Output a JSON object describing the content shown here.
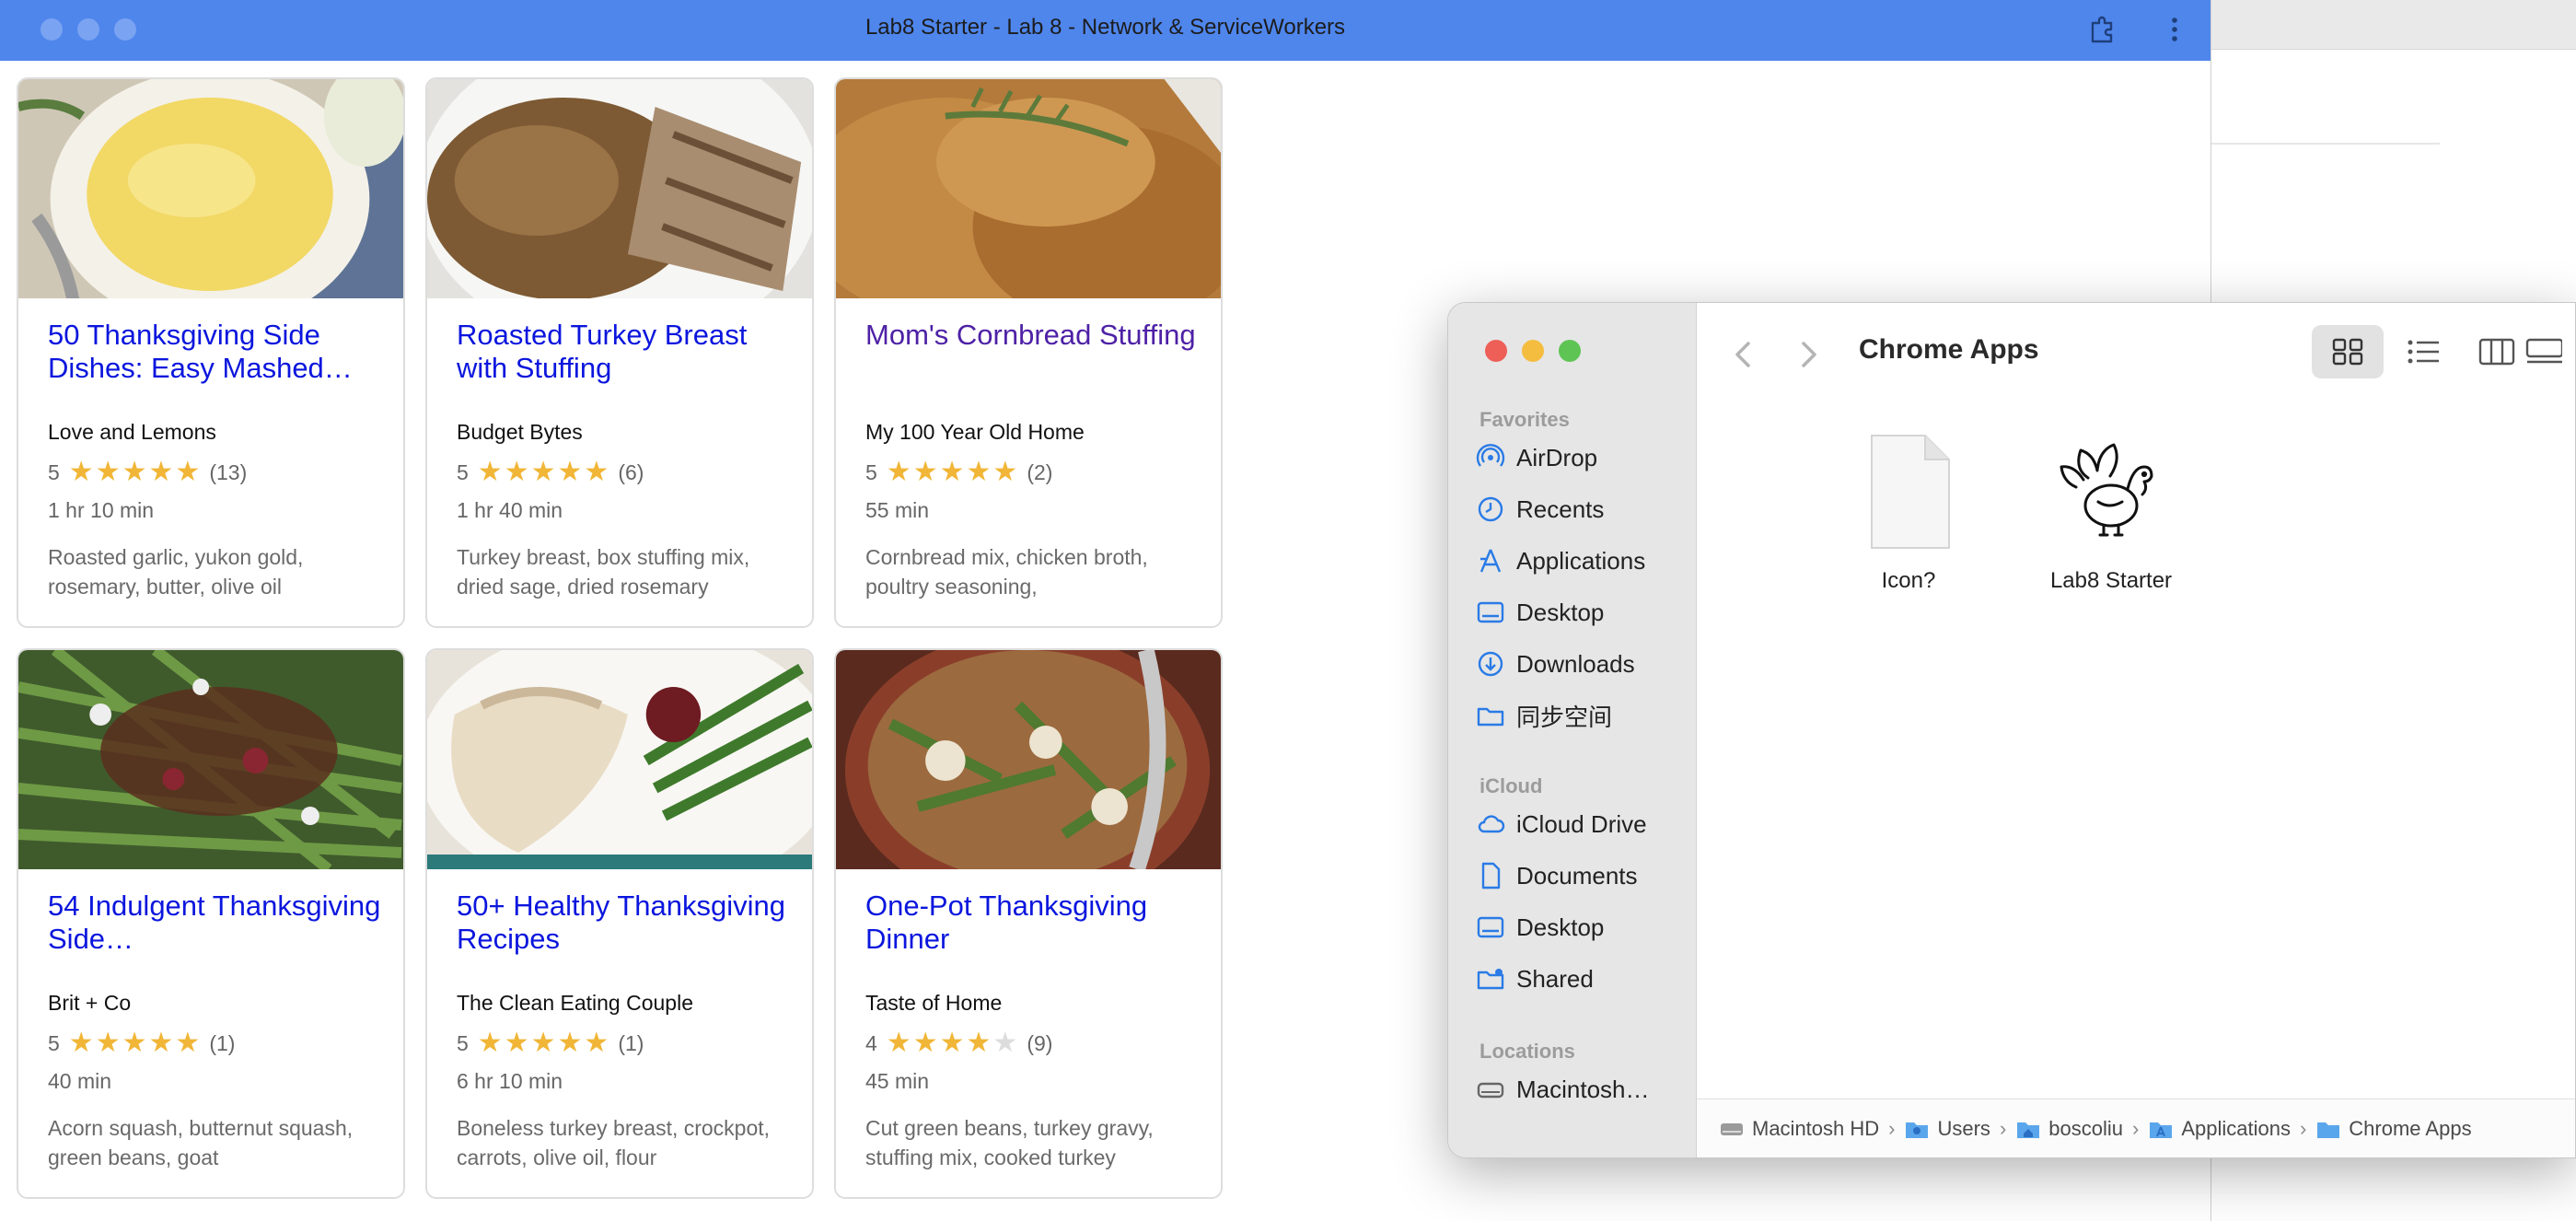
{
  "app_window": {
    "title": "Lab8 Starter - Lab 8 - Network & ServiceWorkers",
    "titlebar_color": "#4f86ec"
  },
  "recipes": [
    {
      "title": "50 Thanksgiving Side Dishes: Easy Mashed…",
      "org": "Love and Lemons",
      "rating": "5",
      "stars": 5,
      "count": "(13)",
      "time": "1 hr 10 min",
      "ingredients": "Roasted garlic, yukon gold, rosemary, butter, olive oil",
      "visited": false
    },
    {
      "title": "Roasted Turkey Breast with Stuffing",
      "org": "Budget Bytes",
      "rating": "5",
      "stars": 5,
      "count": "(6)",
      "time": "1 hr 40 min",
      "ingredients": "Turkey breast, box stuffing mix, dried sage, dried rosemary",
      "visited": false
    },
    {
      "title": "Mom's Cornbread Stuffing",
      "org": "My 100 Year Old Home",
      "rating": "5",
      "stars": 5,
      "count": "(2)",
      "time": "55 min",
      "ingredients": "Cornbread mix, chicken broth, poultry seasoning,",
      "visited": true
    },
    {
      "title": "54 Indulgent Thanksgiving Side…",
      "org": "Brit + Co",
      "rating": "5",
      "stars": 5,
      "count": "(1)",
      "time": "40 min",
      "ingredients": "Acorn squash, butternut squash, green beans, goat",
      "visited": false
    },
    {
      "title": "50+ Healthy Thanksgiving Recipes",
      "org": "The Clean Eating Couple",
      "rating": "5",
      "stars": 5,
      "count": "(1)",
      "time": "6 hr 10 min",
      "ingredients": "Boneless turkey breast, crockpot, carrots, olive oil, flour",
      "visited": false
    },
    {
      "title": "One-Pot Thanksgiving Dinner",
      "org": "Taste of Home",
      "rating": "4",
      "stars": 4,
      "count": "(9)",
      "time": "45 min",
      "ingredients": "Cut green beans, turkey gravy, stuffing mix, cooked turkey",
      "visited": false
    }
  ],
  "finder": {
    "folder_title": "Chrome Apps",
    "sidebar": {
      "favorites_label": "Favorites",
      "favorites": [
        {
          "label": "AirDrop",
          "icon": "airdrop-icon"
        },
        {
          "label": "Recents",
          "icon": "recents-icon"
        },
        {
          "label": "Applications",
          "icon": "applications-icon"
        },
        {
          "label": "Desktop",
          "icon": "desktop-icon"
        },
        {
          "label": "Downloads",
          "icon": "downloads-icon"
        },
        {
          "label": "同步空间",
          "icon": "folder-icon"
        }
      ],
      "icloud_label": "iCloud",
      "icloud": [
        {
          "label": "iCloud Drive",
          "icon": "icloud-drive-icon"
        },
        {
          "label": "Documents",
          "icon": "documents-icon"
        },
        {
          "label": "Desktop",
          "icon": "desktop-icon"
        },
        {
          "label": "Shared",
          "icon": "shared-folder-icon"
        }
      ],
      "locations_label": "Locations",
      "locations": [
        {
          "label": "Macintosh…",
          "icon": "disk-icon"
        }
      ]
    },
    "files": [
      {
        "label": "Icon?",
        "icon": "blank-document-icon"
      },
      {
        "label": "Lab8 Starter",
        "icon": "turkey-app-icon"
      }
    ],
    "path": [
      "Macintosh HD",
      "Users",
      "boscoliu",
      "Applications",
      "Chrome Apps"
    ]
  },
  "colors": {
    "link": "#0b16dd",
    "visited_link": "#4e21a6",
    "star": "#f1b637",
    "accent": "#2a7be6"
  }
}
